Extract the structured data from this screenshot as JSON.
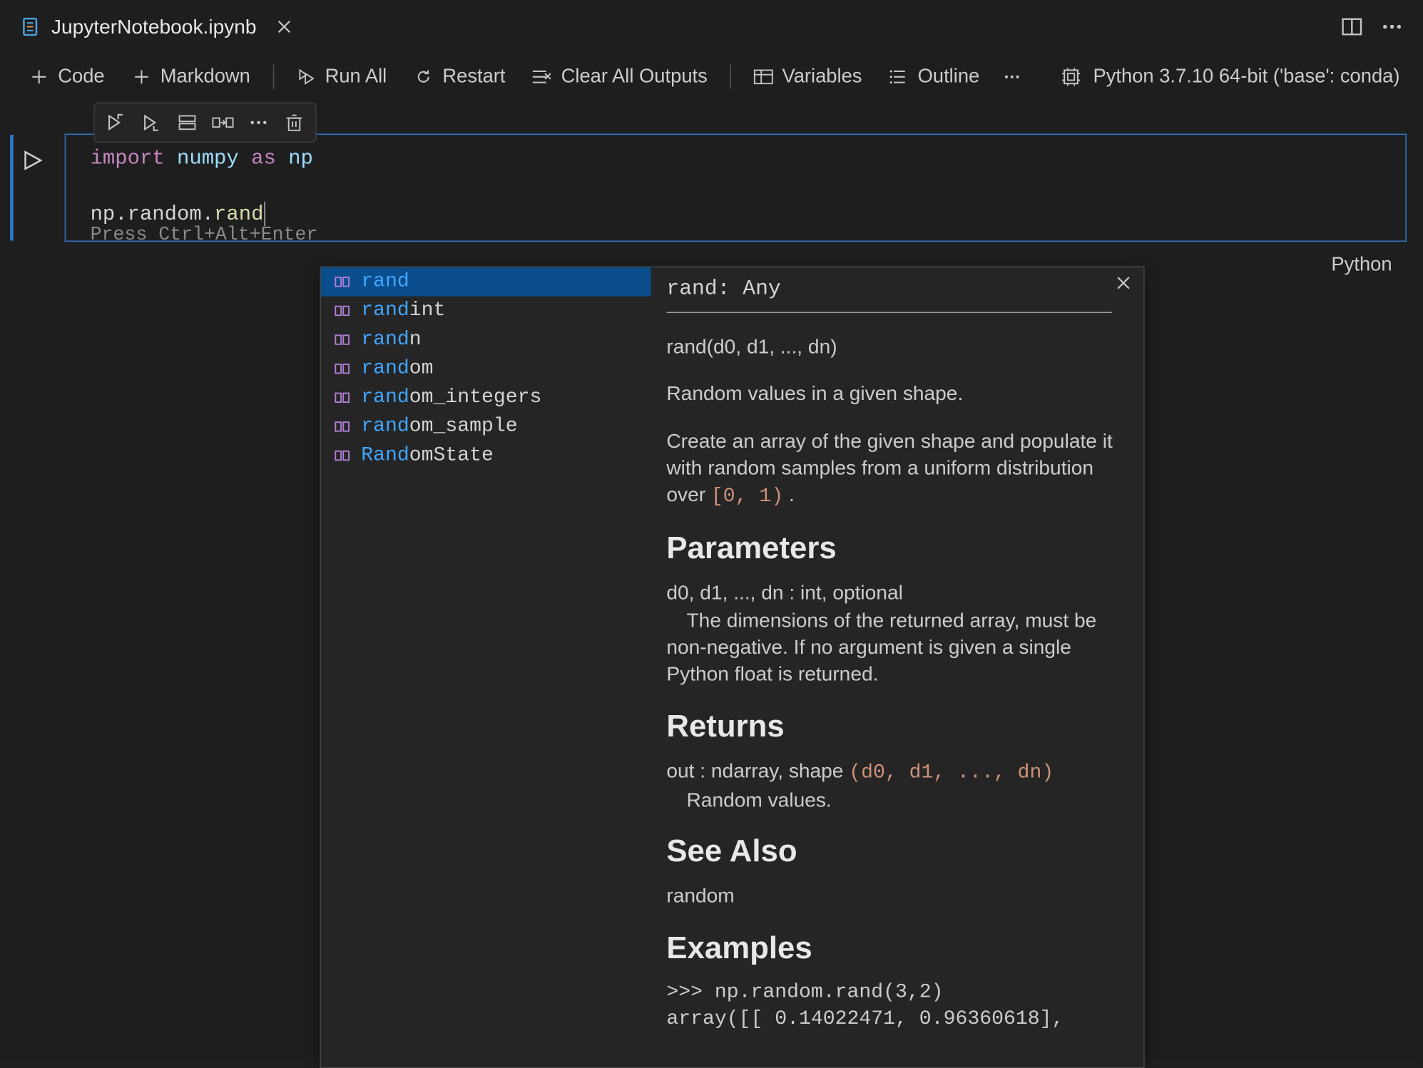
{
  "tab": {
    "filename": "JupyterNotebook.ipynb"
  },
  "toolbar": {
    "code": "Code",
    "markdown": "Markdown",
    "runall": "Run All",
    "restart": "Restart",
    "clearall": "Clear All Outputs",
    "variables": "Variables",
    "outline": "Outline"
  },
  "kernel": {
    "label": "Python 3.7.10 64-bit ('base': conda)"
  },
  "code": {
    "line1_import": "import",
    "line1_numpy": "numpy",
    "line1_as": "as",
    "line1_np": "np",
    "line3_prefix": "np.random.",
    "line3_typed": "rand",
    "hint": "Press Ctrl+Alt+Enter"
  },
  "langlabel": "Python",
  "suggest": {
    "items": [
      {
        "match": "rand",
        "rest": ""
      },
      {
        "match": "rand",
        "rest": "int"
      },
      {
        "match": "rand",
        "rest": "n"
      },
      {
        "match": "rand",
        "rest": "om"
      },
      {
        "match": "rand",
        "rest": "om_integers"
      },
      {
        "match": "rand",
        "rest": "om_sample"
      },
      {
        "match": "Rand",
        "rest": "omState"
      }
    ],
    "doc": {
      "signature": "rand: Any",
      "call": "rand(d0, d1, ..., dn)",
      "summary": "Random values in a given shape.",
      "description_pre": "Create an array of the given shape and populate it with random samples from a uniform distribution over ",
      "description_code": "[0, 1)",
      "description_post": " .",
      "h_parameters": "Parameters",
      "parameters_p1": "d0, d1, ..., dn : int, optional",
      "parameters_p2": " The dimensions of the returned array, must be non-negative. If no argument is given a single Python float is returned.",
      "h_returns": "Returns",
      "returns_p1_pre": "out : ndarray, shape ",
      "returns_p1_code": "(d0, d1, ..., dn)",
      "returns_p2": " Random values.",
      "h_seealso": "See Also",
      "seealso_p": "random",
      "h_examples": "Examples",
      "examples_l1": ">>> np.random.rand(3,2)",
      "examples_l2": "array([[ 0.14022471,  0.96360618],"
    }
  }
}
